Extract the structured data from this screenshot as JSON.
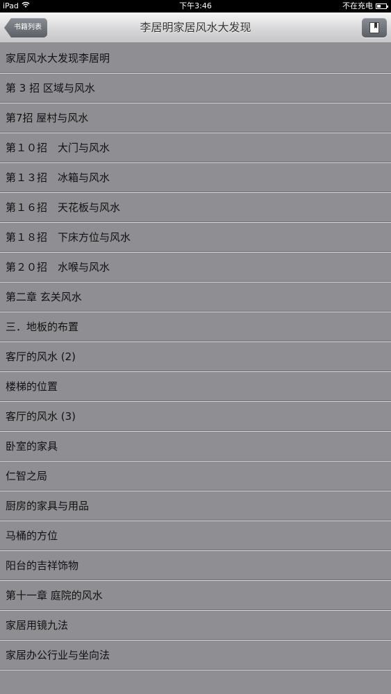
{
  "status_bar": {
    "device": "iPad",
    "time": "下午3:46",
    "charging": "不在充电"
  },
  "nav": {
    "back_label": "书籍列表",
    "title": "李居明家居风水大发现",
    "bookmark_icon": "bookmark-icon"
  },
  "chapters": [
    "家居风水大发现李居明",
    "第 3 招 区域与风水",
    "第7招 屋村与风水",
    "第１０招　大门与风水",
    "第１３招　冰箱与风水",
    "第１６招　天花板与风水",
    "第１８招　下床方位与风水",
    "第２０招　水喉与风水",
    "第二章 玄关风水",
    "三．地板的布置",
    "客厅的风水 (2)",
    "楼梯的位置",
    "客厅的风水 (3)",
    "卧室的家具",
    "仁智之局",
    "厨房的家具与用品",
    "马桶的方位",
    "阳台的吉祥饰物",
    "第十一章 庭院的风水",
    "家居用镜九法",
    "家居办公行业与坐向法"
  ]
}
